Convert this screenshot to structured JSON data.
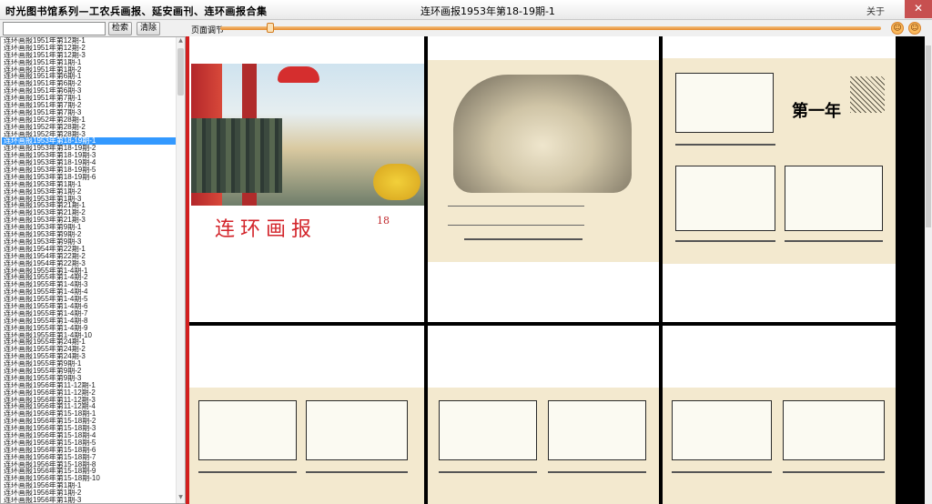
{
  "window": {
    "app_title": "时光图书馆系列—工农兵画报、延安画刊、连环画报合集",
    "doc_title": "连环画报1953年第18-19期-1",
    "about_label": "关于",
    "close_label": "✕"
  },
  "toolbar": {
    "search_placeholder": "",
    "search_button": "检索",
    "clear_button": "清除",
    "zoom_label": "页面调节",
    "zoom_level": 0.07,
    "zoom_out_icon": "☺",
    "zoom_in_icon": "☺"
  },
  "sidebar": {
    "selected_index": 14,
    "items": [
      "连环画报1951年第12期-1",
      "连环画报1951年第12期-2",
      "连环画报1951年第12期-3",
      "连环画报1951年第1期-1",
      "连环画报1951年第1期-2",
      "连环画报1951年第6期-1",
      "连环画报1951年第6期-2",
      "连环画报1951年第6期-3",
      "连环画报1951年第7期-1",
      "连环画报1951年第7期-2",
      "连环画报1951年第7期-3",
      "连环画报1952年第28期-1",
      "连环画报1952年第28期-2",
      "连环画报1952年第28期-3",
      "连环画报1953年第18-19期-1",
      "连环画报1953年第18-19期-2",
      "连环画报1953年第18-19期-3",
      "连环画报1953年第18-19期-4",
      "连环画报1953年第18-19期-5",
      "连环画报1953年第18-19期-6",
      "连环画报1953年第1期-1",
      "连环画报1953年第1期-2",
      "连环画报1953年第1期-3",
      "连环画报1953年第21期-1",
      "连环画报1953年第21期-2",
      "连环画报1953年第21期-3",
      "连环画报1953年第9期-1",
      "连环画报1953年第9期-2",
      "连环画报1953年第9期-3",
      "连环画报1954年第22期-1",
      "连环画报1954年第22期-2",
      "连环画报1954年第22期-3",
      "连环画报1955年第1-4期-1",
      "连环画报1955年第1-4期-2",
      "连环画报1955年第1-4期-3",
      "连环画报1955年第1-4期-4",
      "连环画报1955年第1-4期-5",
      "连环画报1955年第1-4期-6",
      "连环画报1955年第1-4期-7",
      "连环画报1955年第1-4期-8",
      "连环画报1955年第1-4期-9",
      "连环画报1955年第1-4期-10",
      "连环画报1955年第24期-1",
      "连环画报1955年第24期-2",
      "连环画报1955年第24期-3",
      "连环画报1955年第9期-1",
      "连环画报1955年第9期-2",
      "连环画报1955年第9期-3",
      "连环画报1956年第11-12期-1",
      "连环画报1956年第11-12期-2",
      "连环画报1956年第11-12期-3",
      "连环画报1956年第11-12期-4",
      "连环画报1956年第15-18期-1",
      "连环画报1956年第15-18期-2",
      "连环画报1956年第15-18期-3",
      "连环画报1956年第15-18期-4",
      "连环画报1956年第15-18期-5",
      "连环画报1956年第15-18期-6",
      "连环画报1956年第15-18期-7",
      "连环画报1956年第15-18期-8",
      "连环画报1956年第15-18期-9",
      "连环画报1956年第15-18期-10",
      "连环画报1956年第1期-1",
      "连环画报1956年第1期-2",
      "连环画报1956年第1期-3"
    ]
  },
  "pages": {
    "cover_title": "连环画报",
    "cover_issue": "18",
    "page1_heading": "第一年",
    "colors": {
      "accent": "#d21f1f",
      "paper": "#f3e9cf"
    }
  }
}
